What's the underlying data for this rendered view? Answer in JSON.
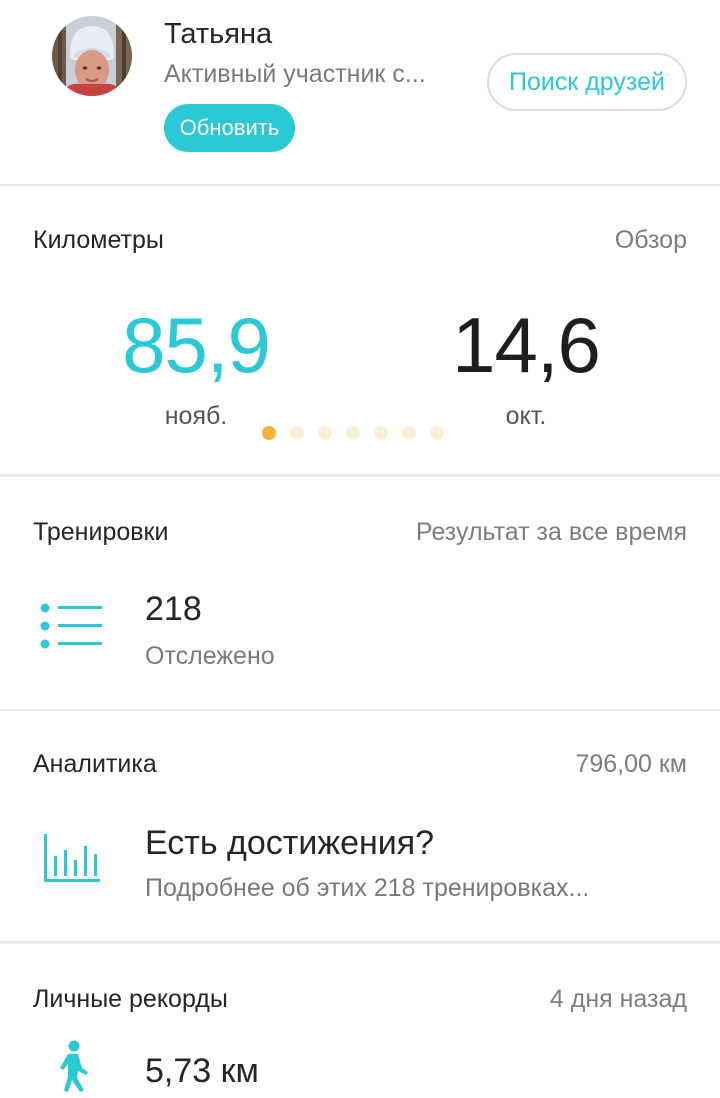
{
  "profile": {
    "name": "Татьяна",
    "status": "Активный участник с...",
    "update_label": "Обновить",
    "find_friends_label": "Поиск друзей"
  },
  "kilometers": {
    "title": "Километры",
    "overview_label": "Обзор",
    "current_value": "85,9",
    "current_month": "нояб.",
    "previous_value": "14,6",
    "previous_month": "окт.",
    "page_count": 7,
    "active_page": 1
  },
  "workouts": {
    "title": "Тренировки",
    "right_label": "Результат за все время",
    "count": "218",
    "count_label": "Отслежено"
  },
  "analytics": {
    "title": "Аналитика",
    "total_distance": "796,00 км",
    "heading": "Есть достижения?",
    "subtext": "Подробнее об этих 218 тренировках..."
  },
  "records": {
    "title": "Личные рекорды",
    "time_ago": "4 дня назад",
    "value": "5,73 км"
  },
  "colors": {
    "accent": "#2bc8d6",
    "dot_active": "#f3b33d",
    "dot_inactive": "#fbeed8"
  },
  "icons": {
    "list": "list-icon",
    "analytics": "bar-chart-icon",
    "walking": "walking-person-icon"
  }
}
